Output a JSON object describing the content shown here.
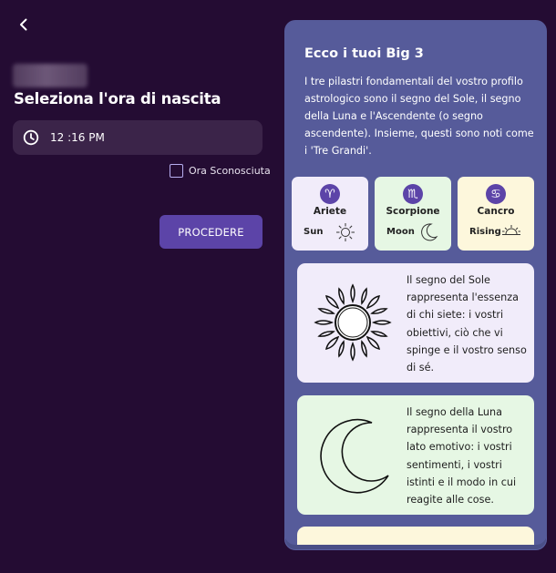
{
  "header": {
    "title": "Seleziona l'ora di nascita"
  },
  "time_picker": {
    "value": "12 :16 PM"
  },
  "unknown_time": {
    "label": "Ora Sconosciuta",
    "checked": false
  },
  "proceed_button": {
    "label": "PROCEDERE"
  },
  "panel": {
    "title": "Ecco i tuoi Big 3",
    "intro": "I tre pilastri fondamentali del vostro profilo astrologico sono il segno del Sole, il segno della Luna e l'Ascendente (o segno ascendente). Insieme, questi sono noti come i 'Tre Grandi'.",
    "signs": [
      {
        "name": "Ariete",
        "role": "Sun",
        "glyph": "♈",
        "bg": "#f1ecfa",
        "icon": "sun-icon"
      },
      {
        "name": "Scorpione",
        "role": "Moon",
        "glyph": "♏",
        "bg": "#e6f7e4",
        "icon": "moon-icon"
      },
      {
        "name": "Cancro",
        "role": "Rising",
        "glyph": "♋",
        "bg": "#fdf7dc",
        "icon": "rising-icon"
      }
    ],
    "cards": [
      {
        "text": "Il segno del Sole rappresenta l'essenza di chi siete: i vostri obiettivi, ciò che vi spinge e il vostro senso di sé.",
        "bg": "#f1ecfa",
        "icon": "sun-illustration"
      },
      {
        "text": "Il segno della Luna rappresenta il vostro lato emotivo: i vostri sentimenti, i vostri istinti e il modo in cui reagite alle cose.",
        "bg": "#e6f7e4",
        "icon": "moon-illustration"
      }
    ],
    "next_card_bg": "#fdf7dc"
  },
  "colors": {
    "background": "#240c33",
    "panel": "#565b9a",
    "accent": "#5c44a8",
    "field": "#3b2449"
  }
}
